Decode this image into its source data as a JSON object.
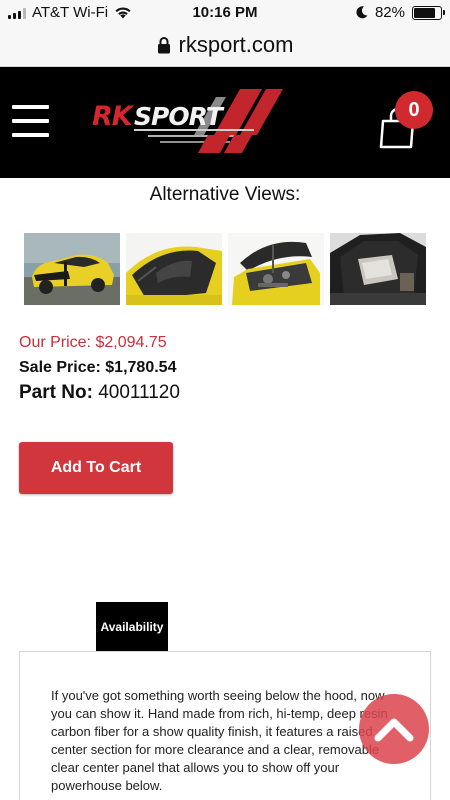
{
  "status_bar": {
    "carrier": "AT&T Wi-Fi",
    "time": "10:16 PM",
    "battery": "82%",
    "battery_level": 0.82,
    "icons": [
      "signal-icon",
      "wifi-icon",
      "moon-icon",
      "battery-icon"
    ]
  },
  "browser": {
    "url": "rksport.com",
    "icons": [
      "lock-icon"
    ]
  },
  "header": {
    "logo_text": "RKSPORT",
    "cart_count": "0",
    "icons": [
      "hamburger-menu-icon",
      "shopping-bag-icon"
    ],
    "colors": {
      "background": "#000000",
      "brand_red": "#d02a2f"
    }
  },
  "product": {
    "alt_views_heading": "Alternative Views:",
    "thumbnails": [
      {
        "name": "yellow-camaro-front-view"
      },
      {
        "name": "carbon-hood-top-view"
      },
      {
        "name": "open-hood-engine-view"
      },
      {
        "name": "hood-clear-panel-view"
      }
    ],
    "our_price_label": "Our Price:",
    "our_price": "$2,094.75",
    "sale_price_label": "Sale Price:",
    "sale_price": "$1,780.54",
    "part_no_label": "Part No:",
    "part_no": "40011120",
    "add_to_cart": "Add To Cart",
    "colors": {
      "our_price": "#c7303a",
      "button": "#d1363c"
    }
  },
  "tabs": {
    "availability": "Availability"
  },
  "description": "If you've got something worth seeing below the hood, now you can show it. Hand made from rich, hi-temp, deep resin carbon fiber for a show quality finish, it features a raised center section for more clearance and a clear, removable clear center panel that allows you to show off your powerhouse below.",
  "floating": {
    "icons": [
      "chevron-up-icon"
    ]
  }
}
